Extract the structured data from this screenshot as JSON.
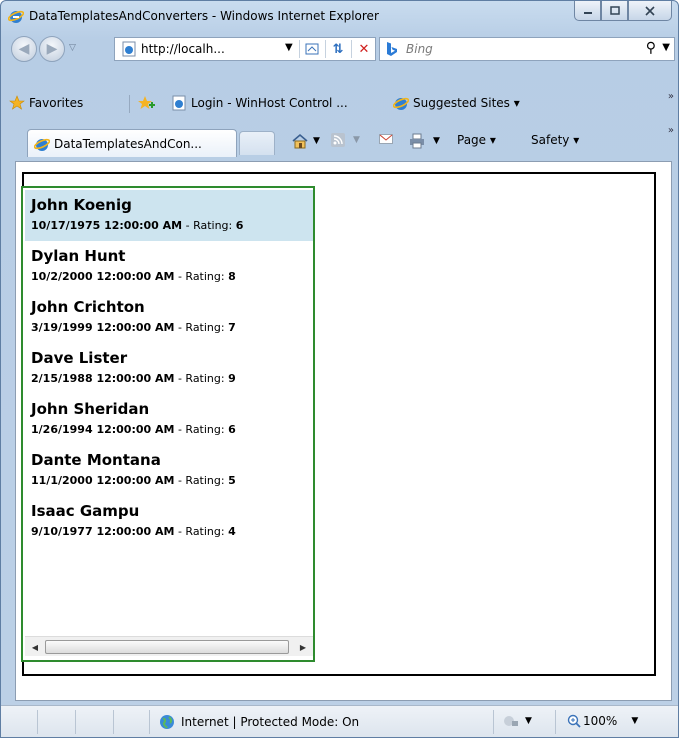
{
  "window": {
    "title": "DataTemplatesAndConverters - Windows Internet Explorer"
  },
  "address": {
    "url": "http://localh...",
    "search_placeholder": "Bing"
  },
  "favorites": {
    "label": "Favorites",
    "items": [
      {
        "label": "Login - WinHost Control ..."
      },
      {
        "label": "Suggested Sites ▾"
      }
    ]
  },
  "tab": {
    "label": "DataTemplatesAndCon..."
  },
  "commands": {
    "page": "Page ▾",
    "safety": "Safety ▾"
  },
  "list": {
    "rating_label": " - Rating: ",
    "items": [
      {
        "name": "John Koenig",
        "date": "10/17/1975 12:00:00 AM",
        "rating": "6",
        "selected": true
      },
      {
        "name": "Dylan Hunt",
        "date": "10/2/2000 12:00:00 AM",
        "rating": "8"
      },
      {
        "name": "John Crichton",
        "date": "3/19/1999 12:00:00 AM",
        "rating": "7"
      },
      {
        "name": "Dave Lister",
        "date": "2/15/1988 12:00:00 AM",
        "rating": "9"
      },
      {
        "name": "John Sheridan",
        "date": "1/26/1994 12:00:00 AM",
        "rating": "6"
      },
      {
        "name": "Dante Montana",
        "date": "11/1/2000 12:00:00 AM",
        "rating": "5"
      },
      {
        "name": "Isaac Gampu",
        "date": "9/10/1977 12:00:00 AM",
        "rating": "4"
      }
    ]
  },
  "status": {
    "zone": "Internet | Protected Mode: On",
    "zoom": "100%"
  },
  "colors": {
    "selected_row": "#cde4ef",
    "listbox_border": "#2e8b2e"
  }
}
